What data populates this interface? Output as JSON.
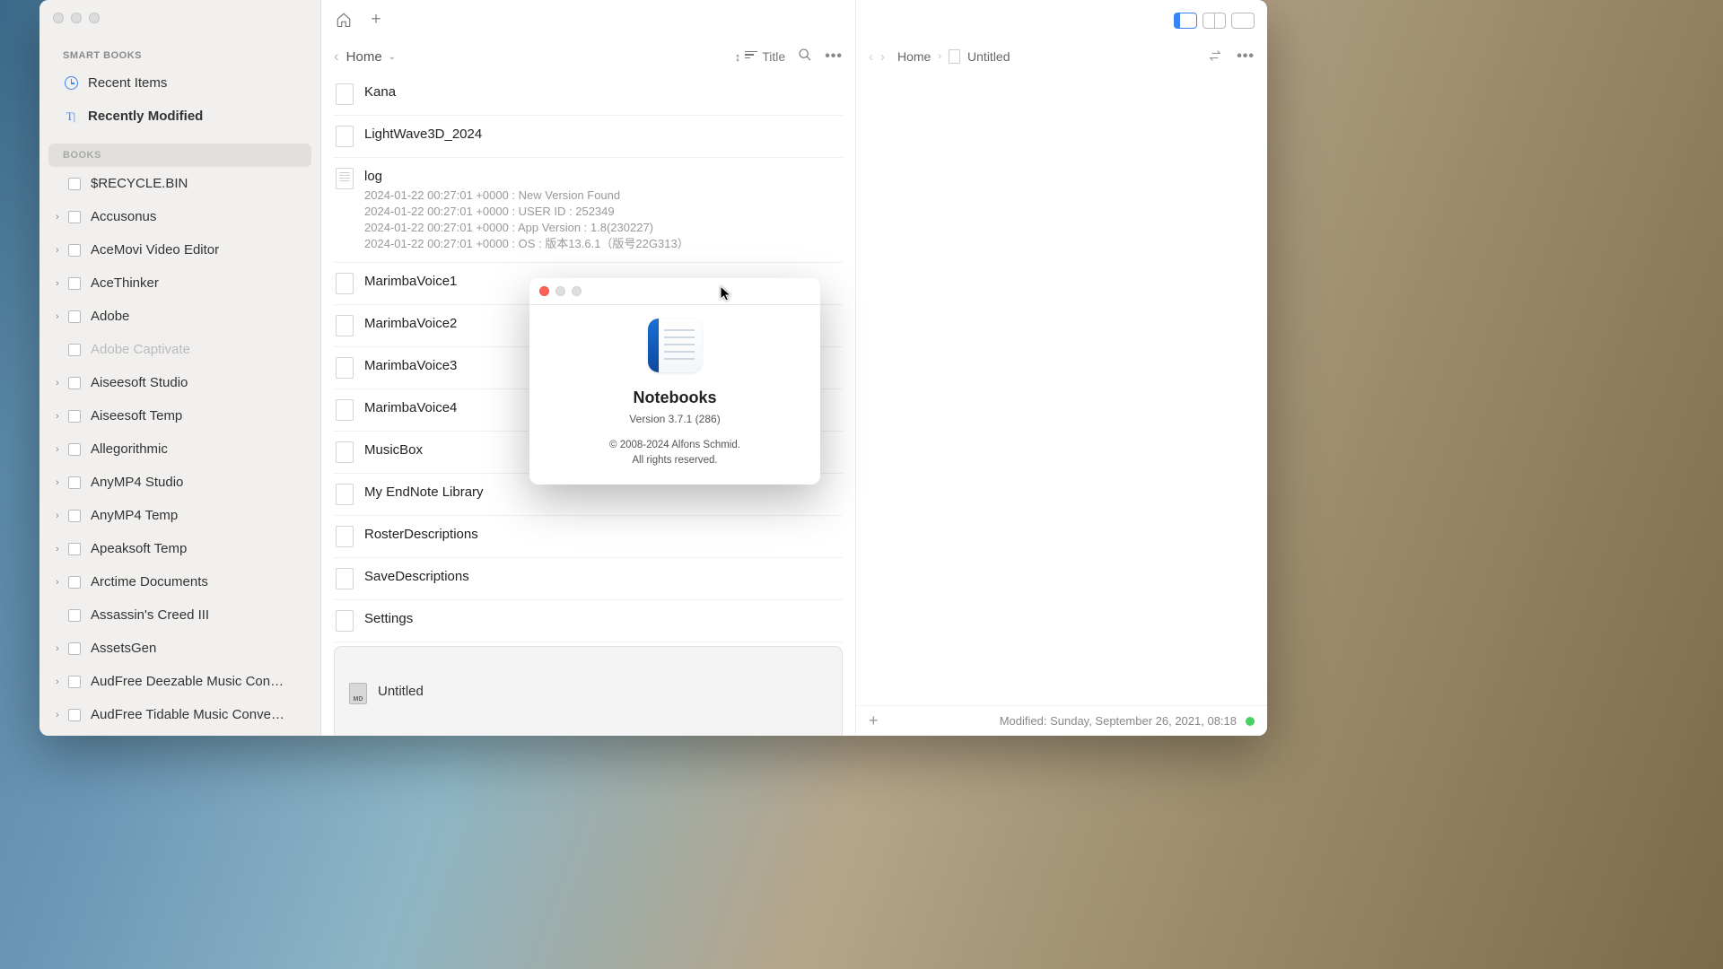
{
  "sidebar": {
    "smart_books_header": "SMART BOOKS",
    "recent_items": "Recent Items",
    "recently_modified": "Recently Modified",
    "books_header": "BOOKS",
    "books": [
      {
        "label": "$RECYCLE.BIN",
        "expandable": false
      },
      {
        "label": "Accusonus",
        "expandable": true
      },
      {
        "label": "AceMovi Video Editor",
        "expandable": true
      },
      {
        "label": "AceThinker",
        "expandable": true
      },
      {
        "label": "Adobe",
        "expandable": true
      },
      {
        "label": "Adobe Captivate",
        "expandable": false,
        "disabled": true
      },
      {
        "label": "Aiseesoft Studio",
        "expandable": true
      },
      {
        "label": "Aiseesoft Temp",
        "expandable": true
      },
      {
        "label": "Allegorithmic",
        "expandable": true
      },
      {
        "label": "AnyMP4 Studio",
        "expandable": true
      },
      {
        "label": "AnyMP4 Temp",
        "expandable": true
      },
      {
        "label": "Apeaksoft Temp",
        "expandable": true
      },
      {
        "label": "Arctime Documents",
        "expandable": true
      },
      {
        "label": "Assassin's Creed III",
        "expandable": false
      },
      {
        "label": "AssetsGen",
        "expandable": true
      },
      {
        "label": "AudFree Deezable Music Conve…",
        "expandable": true
      },
      {
        "label": "AudFree Tidable Music Converter",
        "expandable": true
      }
    ]
  },
  "mid": {
    "breadcrumb": "Home",
    "sort_label": "Title",
    "items": [
      {
        "title": "Kana",
        "type": "file"
      },
      {
        "title": "LightWave3D_2024",
        "type": "file"
      },
      {
        "title": "log",
        "type": "note",
        "preview": "2024-01-22 00:27:01 +0000 : New Version Found\n2024-01-22 00:27:01 +0000 : USER ID : 252349\n2024-01-22 00:27:01 +0000 : App Version : 1.8(230227)\n2024-01-22 00:27:01 +0000 : OS : 版本13.6.1（版号22G313）"
      },
      {
        "title": "MarimbaVoice1",
        "type": "file"
      },
      {
        "title": "MarimbaVoice2",
        "type": "file"
      },
      {
        "title": "MarimbaVoice3",
        "type": "file"
      },
      {
        "title": "MarimbaVoice4",
        "type": "file"
      },
      {
        "title": "MusicBox",
        "type": "file"
      },
      {
        "title": "My EndNote Library",
        "type": "file"
      },
      {
        "title": "RosterDescriptions",
        "type": "file"
      },
      {
        "title": "SaveDescriptions",
        "type": "file"
      },
      {
        "title": "Settings",
        "type": "file"
      },
      {
        "title": "Untitled",
        "type": "md",
        "selected": true
      }
    ]
  },
  "detail": {
    "breadcrumb_home": "Home",
    "breadcrumb_doc": "Untitled",
    "modified": "Modified: Sunday, September 26, 2021, 08:18"
  },
  "about": {
    "app_name": "Notebooks",
    "version": "Version 3.7.1 (286)",
    "copyright_line1": "© 2008-2024 Alfons Schmid.",
    "copyright_line2": "All rights reserved."
  }
}
